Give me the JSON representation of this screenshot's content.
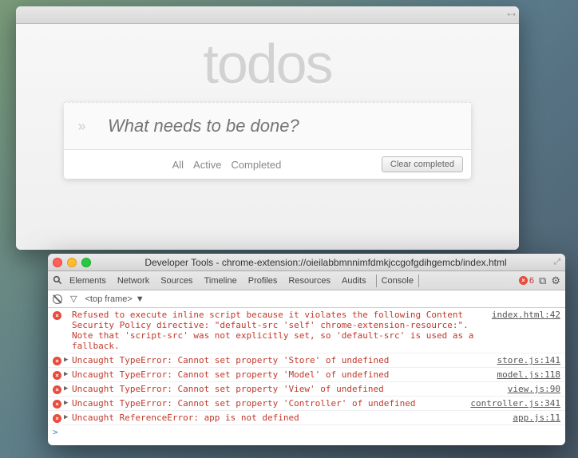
{
  "app": {
    "title": "todos",
    "input_placeholder": "What needs to be done?",
    "filters": [
      "All",
      "Active",
      "Completed"
    ],
    "clear_label": "Clear completed"
  },
  "devtools": {
    "window_title": "Developer Tools - chrome-extension://oieilabbmnnimfdmkjccgofgdihgemcb/index.html",
    "tabs": [
      "Elements",
      "Network",
      "Sources",
      "Timeline",
      "Profiles",
      "Resources",
      "Audits",
      "Console"
    ],
    "active_tab": "Console",
    "error_count": "6",
    "frame_label": "<top frame>",
    "console": [
      {
        "type": "error",
        "expandable": false,
        "text": "Refused to execute inline script because it violates the following Content Security Policy directive: \"default-src 'self' chrome-extension-resource:\". Note that 'script-src' was not explicitly set, so 'default-src' is used as a fallback.",
        "source": "index.html:42"
      },
      {
        "type": "error",
        "expandable": true,
        "text": "Uncaught TypeError: Cannot set property 'Store' of undefined",
        "source": "store.js:141"
      },
      {
        "type": "error",
        "expandable": true,
        "text": "Uncaught TypeError: Cannot set property 'Model' of undefined",
        "source": "model.js:118"
      },
      {
        "type": "error",
        "expandable": true,
        "text": "Uncaught TypeError: Cannot set property 'View' of undefined",
        "source": "view.js:90"
      },
      {
        "type": "error",
        "expandable": true,
        "text": "Uncaught TypeError: Cannot set property 'Controller' of undefined",
        "source": "controller.js:341"
      },
      {
        "type": "error",
        "expandable": true,
        "text": "Uncaught ReferenceError: app is not defined",
        "source": "app.js:11"
      }
    ]
  }
}
